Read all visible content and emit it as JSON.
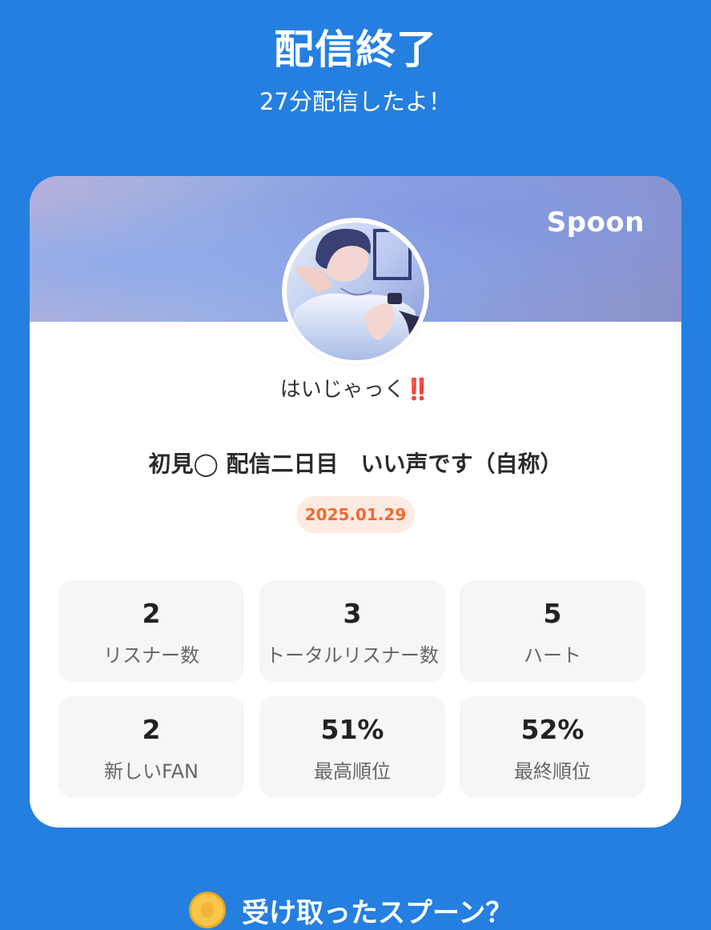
{
  "header": {
    "title": "配信終了",
    "subtitle": "27分配信したよ！"
  },
  "card": {
    "brand": "Spoon",
    "host_name": "はいじゃっく",
    "host_name_emoji": "‼️",
    "stream_title": "初見◯ 配信二日目　いい声です（自称）",
    "date": "2025.01.29",
    "stats": [
      {
        "value": "2",
        "label": "リスナー数"
      },
      {
        "value": "3",
        "label": "トータルリスナー数"
      },
      {
        "value": "5",
        "label": "ハート"
      },
      {
        "value": "2",
        "label": "新しいFAN"
      },
      {
        "value": "51%",
        "label": "最高順位"
      },
      {
        "value": "52%",
        "label": "最終順位"
      }
    ]
  },
  "next_section": {
    "icon": "coin-icon",
    "heading": "受け取ったスプーン？"
  },
  "colors": {
    "background": "#247fe1",
    "card": "#ffffff",
    "date_text": "#ef6b2f",
    "date_bg": "#fdebe3",
    "tile_bg": "#f6f6f6"
  }
}
